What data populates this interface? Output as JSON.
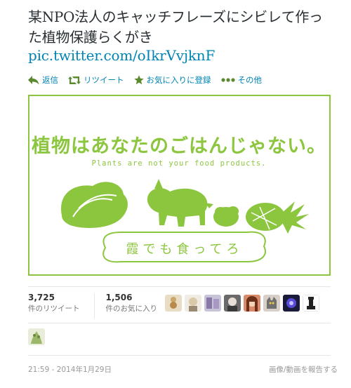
{
  "tweet": {
    "text_line1": "某NPO法人のキャッチフレーズにシビレて作っ",
    "text_line2": "た植物保護らくがき",
    "link": "pic.twitter.com/oIkrVvjknF"
  },
  "actions": {
    "reply": "返信",
    "retweet": "リツイート",
    "favorite": "お気に入りに登録",
    "more": "その他"
  },
  "image": {
    "headline": "植物はあなたのごはんじゃない。",
    "subline": "Plants are not your food products.",
    "banner": "霞でも食ってろ",
    "accent_color": "#8cc63f"
  },
  "stats": {
    "retweets_count": "3,725",
    "retweets_label": "件のリツイート",
    "favorites_count": "1,506",
    "favorites_label": "件のお気に入り"
  },
  "favorer_avatar_icons": [
    "avatar-1-icon",
    "avatar-2-icon",
    "avatar-3-icon",
    "avatar-4-icon",
    "avatar-5-icon",
    "avatar-6-icon",
    "avatar-7-icon",
    "avatar-8-icon",
    "avatar-9-icon"
  ],
  "footer": {
    "timestamp": "21:59 - 2014年1月29日",
    "report": "画像/動画を報告する"
  },
  "colors": {
    "link": "#0084b4",
    "muted": "#999999",
    "plant_green": "#8cc63f"
  }
}
